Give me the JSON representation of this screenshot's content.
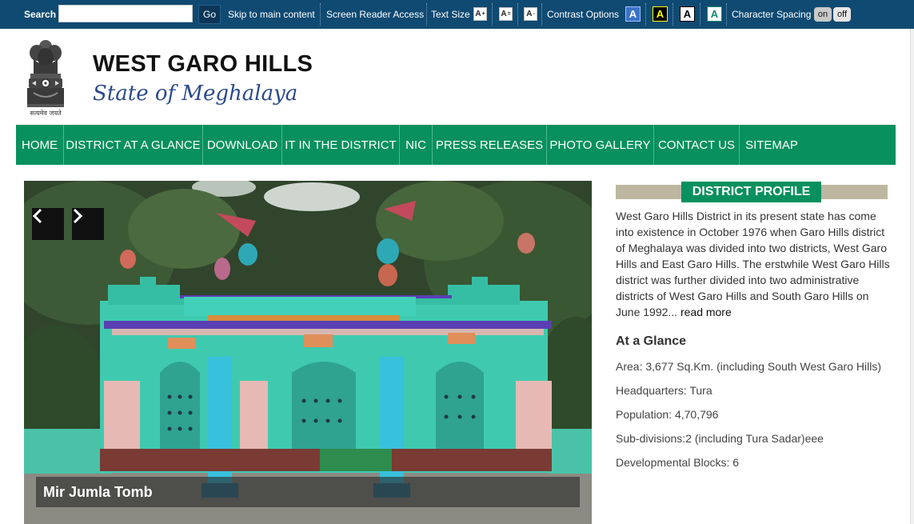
{
  "topbar": {
    "search_label": "Search",
    "search_value": "",
    "go_label": "Go",
    "skip_label": "Skip to main content",
    "screen_reader_label": "Screen Reader Access",
    "text_size_label": "Text Size",
    "text_size_buttons": [
      {
        "letter": "A",
        "mark": "+"
      },
      {
        "letter": "A",
        "mark": "="
      },
      {
        "letter": "A",
        "mark": "-"
      }
    ],
    "contrast_label": "Contrast Options",
    "contrast_buttons": [
      {
        "letter": "A",
        "bg": "#3b73c9",
        "fg": "#ffffff"
      },
      {
        "letter": "A",
        "bg": "#000000",
        "fg": "#ffff00"
      },
      {
        "letter": "A",
        "bg": "#ffffff",
        "fg": "#000000"
      },
      {
        "letter": "A",
        "bg": "#ffffff",
        "fg": "#0a8a6a"
      }
    ],
    "spacing_label": "Character Spacing",
    "spacing_on": "on",
    "spacing_off": "off"
  },
  "header": {
    "emblem_caption": "सत्यमेव जयते",
    "title": "WEST GARO HILLS",
    "subtitle": "State of Meghalaya"
  },
  "nav": {
    "items": [
      "HOME",
      "DISTRICT AT A GLANCE",
      "DOWNLOAD",
      "IT IN THE DISTRICT",
      "NIC",
      "PRESS RELEASES",
      "PHOTO GALLERY",
      "CONTACT US",
      "SITEMAP"
    ]
  },
  "slider": {
    "prev_glyph": "‹",
    "next_glyph": "›",
    "caption": "Mir Jumla Tomb"
  },
  "profile": {
    "title": "DISTRICT PROFILE",
    "text": "West Garo Hills District in its present state has come into existence in October 1976 when Garo Hills district of Meghalaya was divided into two districts, West Garo Hills and East Garo Hills. The erstwhile West Garo Hills district was further divided into two administrative districts of West Garo Hills and South Garo Hills on June 1992...",
    "read_more": "read more"
  },
  "glance": {
    "title": "At a Glance",
    "items": [
      "Area: 3,677 Sq.Km. (including South West Garo Hills)",
      "Headquarters: Tura",
      "Population: 4,70,796",
      "Sub-divisions:2 (including Tura Sadar)eee",
      "Developmental Blocks: 6"
    ]
  },
  "colors": {
    "topbar_bg": "#0f4a72",
    "nav_bg": "#08905f",
    "subtitle": "#2b4a8b"
  }
}
